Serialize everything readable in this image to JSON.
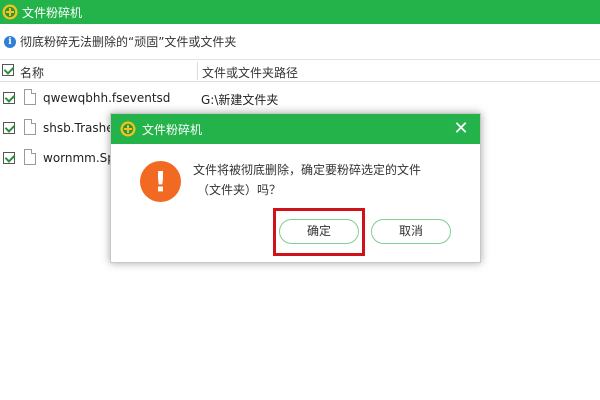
{
  "window": {
    "title": "文件粉碎机"
  },
  "info": {
    "text": "彻底粉碎无法删除的“顽固”文件或文件夹"
  },
  "table": {
    "headers": [
      "名称",
      "文件或文件夹路径"
    ],
    "rows": [
      {
        "name": "qwewqbhh.fseventsd",
        "path": "G:\\新建文件夹",
        "checked": true
      },
      {
        "name": "shsb.Trashe",
        "path": "",
        "checked": true
      },
      {
        "name": "wornmm.Sp",
        "path": "",
        "checked": true
      }
    ]
  },
  "dialog": {
    "title": "文件粉碎机",
    "message_line1": "文件将被彻底删除，确定要粉碎选定的文件",
    "message_line2": "（文件夹）吗？",
    "ok_label": "确定",
    "cancel_label": "取消",
    "warning_symbol": "!",
    "close_symbol": "✕"
  },
  "colors": {
    "titlebar": "#24b34b",
    "warning": "#f26a21",
    "highlight": "#d0121b",
    "button_border": "#7fcf91"
  },
  "icons": {
    "app_logo": "green-plus-shield-icon",
    "info": "info-icon",
    "warning": "exclamation-icon",
    "file": "file-icon",
    "close": "close-icon"
  }
}
